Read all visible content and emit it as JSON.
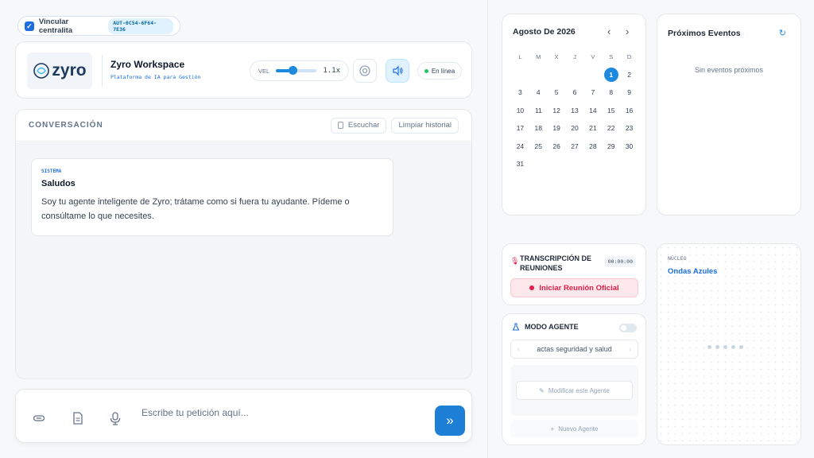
{
  "pbx": {
    "label": "Vincular centralita",
    "id": "AUT-0C54-6F64-7E36",
    "checked": true
  },
  "header": {
    "logo_text": "zyro",
    "title": "Zyro Workspace",
    "subtitle": "Plataforma de IA para Gestión",
    "speed_label": "VEL",
    "speed_value": "1.1x",
    "speed_fraction": 0.4,
    "status": "En línea"
  },
  "conversation": {
    "title": "CONVERSACIÓN",
    "listen_label": "Escuchar",
    "clear_label": "Limpiar historial",
    "messages": [
      {
        "tag": "SISTEMA",
        "title": "Saludos",
        "body": "Soy tu agente inteligente de Zyro; trátame como si fuera tu ayudante. Pídeme o consúltame lo que necesites."
      }
    ]
  },
  "composer": {
    "placeholder": "Escribe tu petición aquí...",
    "send_icon": "double-chevron-right"
  },
  "calendar": {
    "title": "Agosto De 2026",
    "weekdays": [
      "L",
      "M",
      "X",
      "J",
      "V",
      "S",
      "D"
    ],
    "leading_blanks": 5,
    "days": 31,
    "today": 1
  },
  "events": {
    "title": "Próximos Eventos",
    "empty": "Sin eventos próximos"
  },
  "transcription": {
    "title": "TRANSCRIPCIÓN DE REUNIONES",
    "timer": "00:00:00",
    "start_label": "Iniciar Reunión Oficial"
  },
  "agent": {
    "title": "MODO AGENTE",
    "selected": "actas seguridad y salud",
    "modify_label": "Modificar este Agente",
    "new_label": "Nuevo Agente",
    "enabled": false
  },
  "core": {
    "label": "NÚCLEO",
    "name": "Ondas Azules"
  },
  "colors": {
    "accent": "#1d8ae0",
    "danger": "#e11d48",
    "online": "#22c55e"
  }
}
